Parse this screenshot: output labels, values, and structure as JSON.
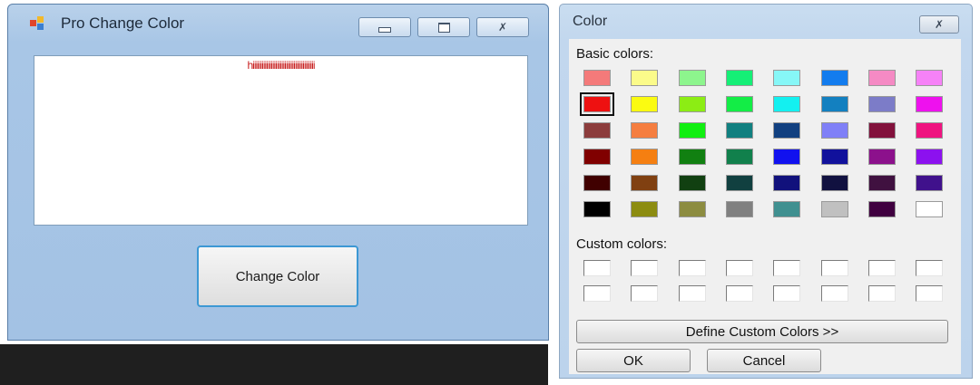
{
  "main_window": {
    "title": "Pro Change Color",
    "client_text": "hiiiiiiiiiiiiiiiiiiiiiiiiiiiiiiiiiiiiiiiii",
    "change_button_label": "Change Color",
    "caption_minimize": "–",
    "caption_maximize": "□",
    "caption_close": "✗"
  },
  "color_dialog": {
    "title": "Color",
    "close_glyph": "✗",
    "basic_colors_label": "Basic colors:",
    "custom_colors_label": "Custom colors:",
    "define_button_label": "Define Custom Colors >>",
    "ok_label": "OK",
    "cancel_label": "Cancel",
    "selected_basic_index": 8,
    "basic_colors": [
      "#f47a7a",
      "#fbfb8a",
      "#8df58d",
      "#15ef76",
      "#86f7f7",
      "#137cee",
      "#f58ac4",
      "#f682f7",
      "#ee1111",
      "#fbfb11",
      "#8ced14",
      "#13ed46",
      "#13f0f0",
      "#1380c0",
      "#7c7cc8",
      "#ee11ee",
      "#8c3c3c",
      "#f57e40",
      "#11ef11",
      "#118080",
      "#114080",
      "#8080f7",
      "#82113c",
      "#ef1380",
      "#800000",
      "#f57f11",
      "#118011",
      "#11804c",
      "#1111ef",
      "#11119c",
      "#8c118c",
      "#8c11ef",
      "#400000",
      "#804011",
      "#114011",
      "#114040",
      "#11117c",
      "#111140",
      "#401140",
      "#40118c",
      "#000000",
      "#8c8c11",
      "#8c8c40",
      "#808080",
      "#409090",
      "#c0c0c0",
      "#400040",
      "#ffffff"
    ],
    "custom_colors_count": 16
  }
}
